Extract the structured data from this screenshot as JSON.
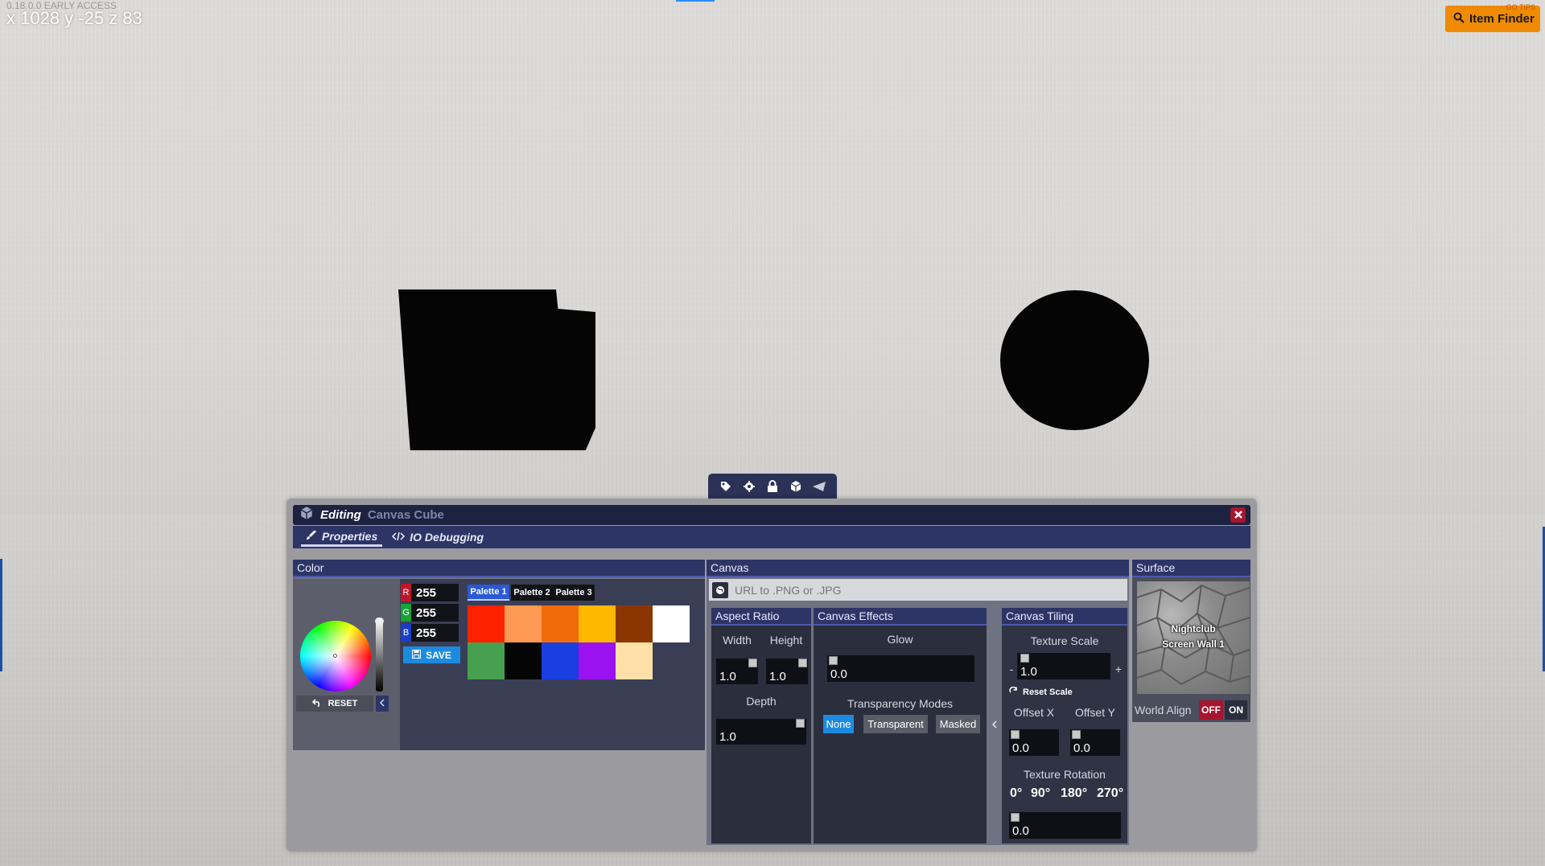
{
  "hud": {
    "version": "0.18.0.0 EARLY ACCESS",
    "coords": "x 1028 y -25 z 83"
  },
  "item_finder": {
    "label": "Item Finder",
    "tips": "GO TIPS",
    "icon": "search-icon"
  },
  "toolbar": {
    "icons": [
      "tag-icon",
      "gear-icon",
      "lock-icon",
      "cube-icon",
      "send-icon"
    ]
  },
  "editor": {
    "mode": "Editing",
    "object_name": "Canvas Cube",
    "tabs": [
      {
        "label": "Properties",
        "icon": "brush-icon",
        "active": true
      },
      {
        "label": "IO Debugging",
        "icon": "code-icon",
        "active": false
      }
    ]
  },
  "color": {
    "title": "Color",
    "r": "255",
    "g": "255",
    "b": "255",
    "r_label": "R",
    "g_label": "G",
    "b_label": "B",
    "save_label": "SAVE",
    "reset_label": "RESET",
    "palette_tabs": [
      "Palette 1",
      "Palette 2",
      "Palette 3"
    ],
    "swatches": [
      "#ff2200",
      "#ff9a55",
      "#f06a0a",
      "#ffb800",
      "#8b3500",
      "#ffffff",
      "#46a050",
      "#050505",
      "#1a3ee0",
      "#9a12f0",
      "#ffe0a8"
    ]
  },
  "canvas": {
    "title": "Canvas",
    "url_placeholder": "URL to .PNG or .JPG",
    "aspect": {
      "title": "Aspect Ratio",
      "width_label": "Width",
      "height_label": "Height",
      "width": "1.0",
      "height": "1.0",
      "depth_label": "Depth",
      "depth": "1.0"
    },
    "effects": {
      "title": "Canvas Effects",
      "glow_label": "Glow",
      "glow": "0.0",
      "modes_label": "Transparency Modes",
      "modes": [
        "None",
        "Transparent",
        "Masked"
      ],
      "active_mode": "None"
    },
    "tiling": {
      "title": "Canvas Tiling",
      "scale_label": "Texture Scale",
      "scale": "1.0",
      "minus": "-",
      "plus": "+",
      "reset_scale": "Reset Scale",
      "offset_x_label": "Offset X",
      "offset_y_label": "Offset Y",
      "offset_x": "0.0",
      "offset_y": "0.0",
      "rotation_label": "Texture Rotation",
      "rotations": [
        "0°",
        "90°",
        "180°",
        "270°"
      ],
      "rotation": "0.0"
    }
  },
  "surface": {
    "title": "Surface",
    "name_line1": "Nightclub",
    "name_line2": "Screen Wall 1",
    "world_align_label": "World Align",
    "off": "OFF",
    "on": "ON"
  },
  "colors": {
    "accent_blue": "#1c8bdf",
    "title_bar": "#1d2240",
    "panel_head": "#2d3566",
    "close_red": "#a6162e",
    "item_finder_orange": "#f08a00"
  }
}
